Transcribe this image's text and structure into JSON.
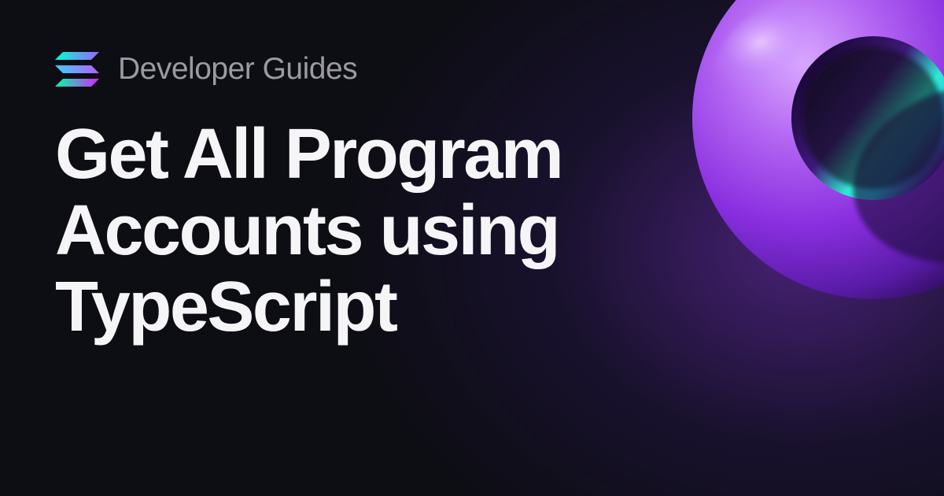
{
  "header": {
    "subtitle": "Developer Guides"
  },
  "main": {
    "title": "Get All Program Accounts using TypeScript"
  }
}
